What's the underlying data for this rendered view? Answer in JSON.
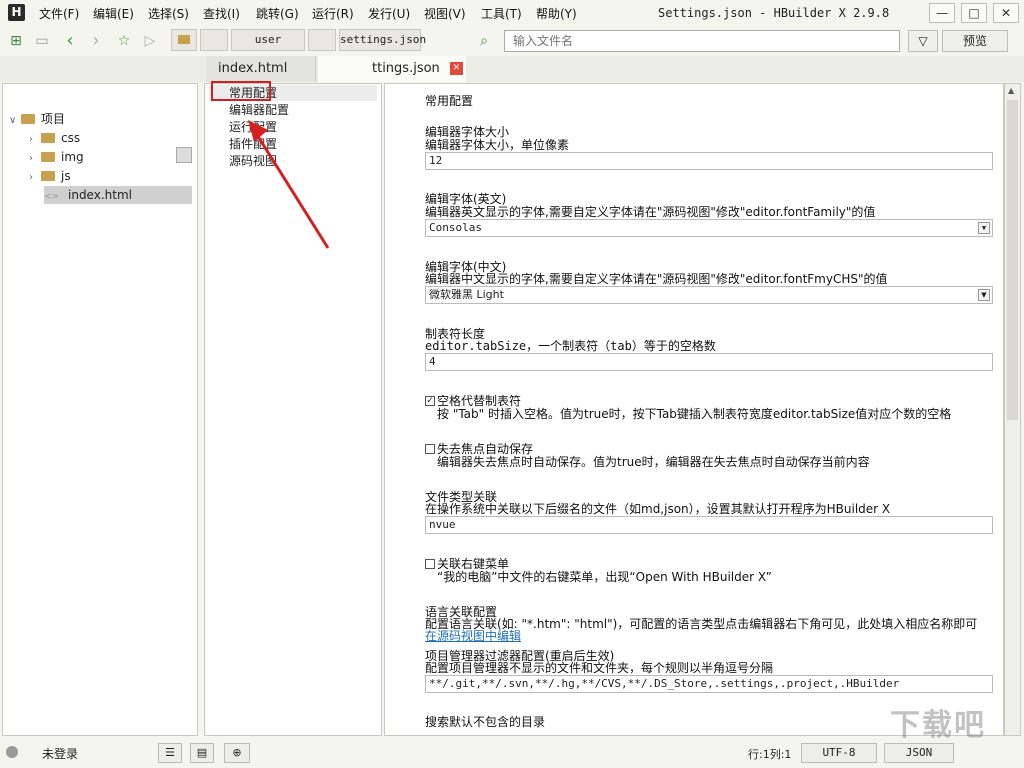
{
  "app": {
    "logo": "H",
    "window_title": "Settings.json - HBuilder X 2.9.8",
    "window_controls": {
      "minimize": "—",
      "maximize": "□",
      "close": "✕"
    }
  },
  "menu": [
    "文件(F)",
    "编辑(E)",
    "选择(S)",
    "查找(I)",
    "跳转(G)",
    "运行(R)",
    "发行(U)",
    "视图(V)",
    "工具(T)",
    "帮助(Y)"
  ],
  "toolbar": {
    "tabs": [
      "user",
      "settings.json"
    ],
    "search_placeholder": "输入文件名",
    "filter_icon": "▽",
    "preview_label": "预览"
  },
  "file_tabs": [
    {
      "label": "index.html",
      "active": false
    },
    {
      "label": "ttings.json",
      "active": true,
      "close": "✕"
    }
  ],
  "project_tree": {
    "root": "项目",
    "items": [
      {
        "label": "css",
        "type": "folder"
      },
      {
        "label": "img",
        "type": "folder"
      },
      {
        "label": "js",
        "type": "folder"
      },
      {
        "label": "index.html",
        "type": "file",
        "selected": true
      }
    ]
  },
  "settings_nav": [
    "常用配置",
    "编辑器配置",
    "运行配置",
    "插件配置",
    "源码视图"
  ],
  "settings": {
    "section_title": "常用配置",
    "font_size": {
      "title": "编辑器字体大小",
      "desc": "编辑器字体大小，单位像素",
      "value": "12"
    },
    "font_en": {
      "title": "编辑字体(英文)",
      "desc": "编辑器英文显示的字体,需要自定义字体请在\"源码视图\"修改\"editor.fontFamily\"的值",
      "value": "Consolas"
    },
    "font_cn": {
      "title": "编辑字体(中文)",
      "desc": "编辑器中文显示的字体,需要自定义字体请在\"源码视图\"修改\"editor.fontFmyCHS\"的值",
      "value": "微软雅黑 Light"
    },
    "tab_size": {
      "title": "制表符长度",
      "desc": "editor.tabSize，一个制表符（tab）等于的空格数",
      "value": "4"
    },
    "insert_spaces": {
      "title": "空格代替制表符",
      "desc": "按 \"Tab\" 时插入空格。值为true时，按下Tab键插入制表符宽度editor.tabSize值对应个数的空格",
      "checked": true
    },
    "auto_save": {
      "title": "失去焦点自动保存",
      "desc": "编辑器失去焦点时自动保存。值为true时，编辑器在失去焦点时自动保存当前内容",
      "checked": false
    },
    "file_assoc": {
      "title": "文件类型关联",
      "desc": "在操作系统中关联以下后缀名的文件（如md,json），设置其默认打开程序为HBuilder X",
      "value": "nvue"
    },
    "context_menu": {
      "title": "关联右键菜单",
      "desc": "“我的电脑”中文件的右键菜单，出现“Open With HBuilder X”",
      "checked": false
    },
    "lang_assoc": {
      "title": "语言关联配置",
      "desc": "配置语言关联(如: \"*.htm\": \"html\")，可配置的语言类型点击编辑器右下角可见，此处填入相应名称即可",
      "link": "在源码视图中编辑"
    },
    "filter": {
      "title": "项目管理器过滤器配置(重启后生效)",
      "desc": "配置项目管理器不显示的文件和文件夹，每个规则以半角逗号分隔",
      "value": "**/.git,**/.svn,**/.hg,**/CVS,**/.DS_Store,.settings,.project,.HBuilder"
    },
    "cut_title": "搜索默认不包含的目录"
  },
  "statusbar": {
    "login": "未登录",
    "position": "行:1列:1",
    "encoding": "UTF-8",
    "language": "JSON"
  },
  "watermark": "下载吧",
  "colors": {
    "highlight": "#d42020",
    "selection": "#d0d0d0",
    "link": "#1d6fb8"
  }
}
